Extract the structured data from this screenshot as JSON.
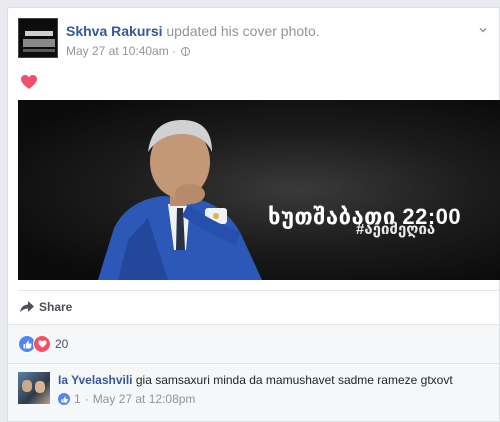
{
  "post": {
    "author": "Skhva Rakursi",
    "action": "updated his cover photo.",
    "timestamp": "May 27 at 10:40am",
    "separator": "·",
    "privacy_icon": "globe-icon",
    "options_icon": "chevron-down-icon",
    "reaction_icon": "heart-icon"
  },
  "cover": {
    "headline": "ხუთშაბათი 22:00",
    "hashtag": "#აეიმეღია"
  },
  "actions": {
    "share_label": "Share"
  },
  "reactions": {
    "count": "20",
    "types": [
      "like",
      "love"
    ]
  },
  "comment": {
    "author": "Ia Yvelashvili",
    "text": "gia samsaxuri minda da mamushavet sadme rameze gtxovt",
    "like_count": "1",
    "timestamp": "May 27 at 12:08pm",
    "separator": "·"
  },
  "colors": {
    "link": "#365899",
    "muted": "#90949c",
    "like_blue": "#4e86f7",
    "love_red": "#f25268",
    "page_bg": "#e9ebee"
  }
}
